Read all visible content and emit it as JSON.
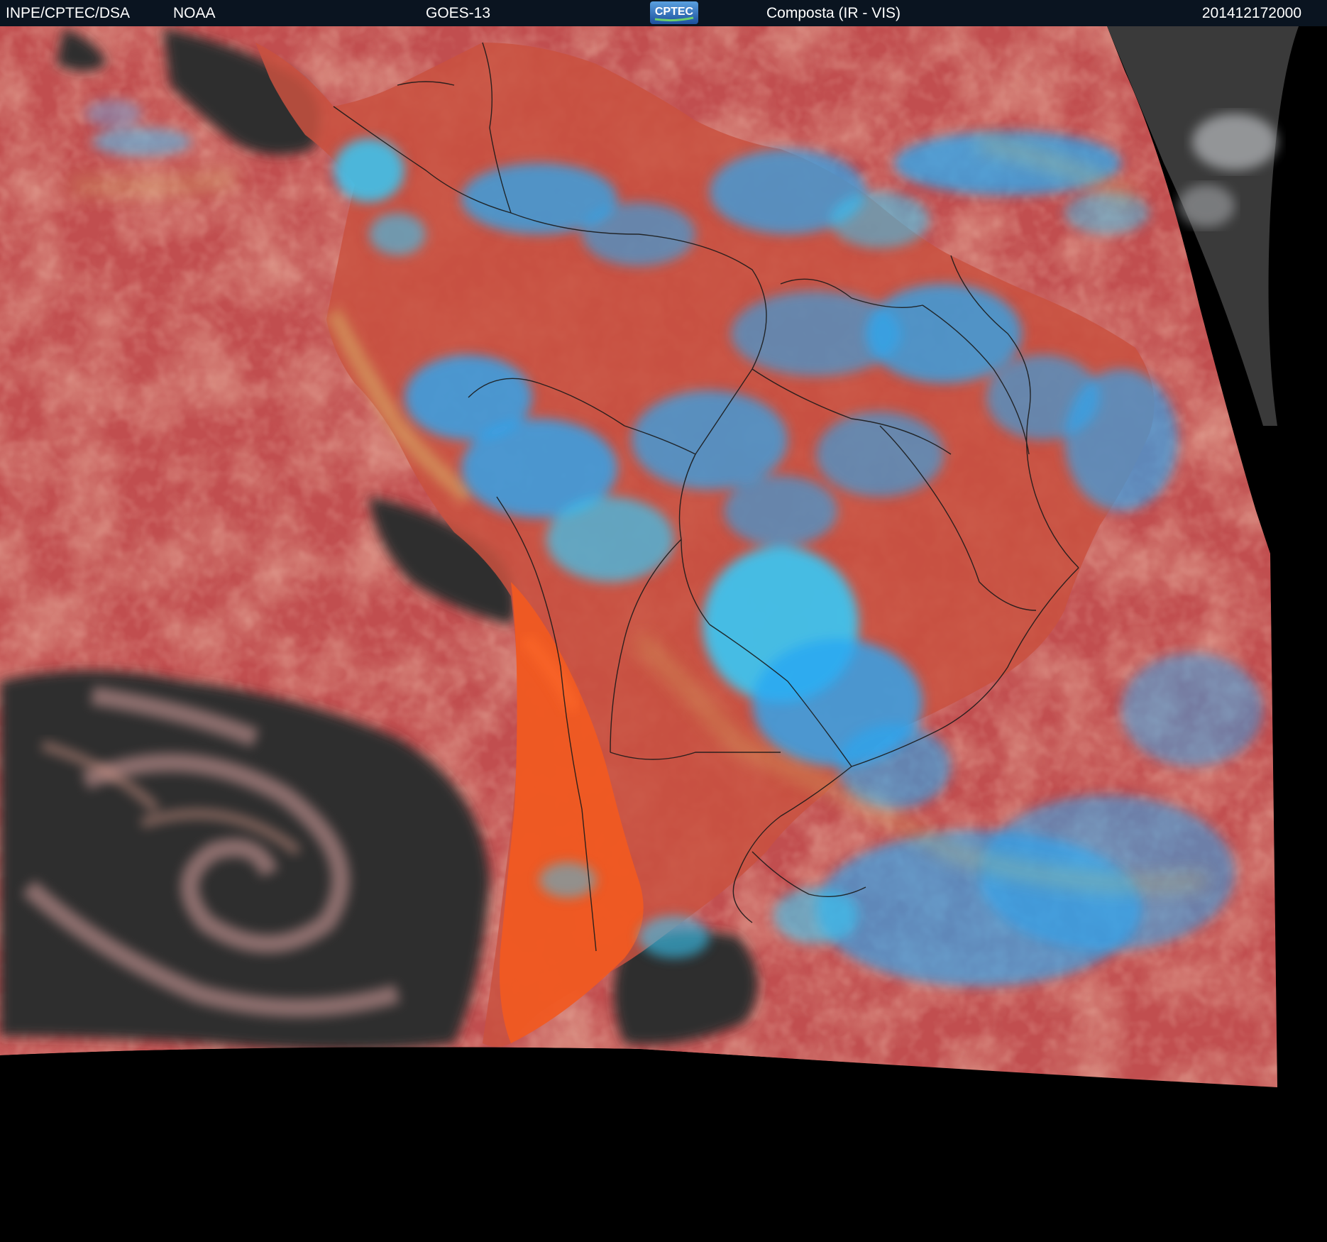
{
  "header": {
    "agency": "INPE/CPTEC/DSA",
    "partner": "NOAA",
    "satellite": "GOES-13",
    "logo_text": "CPTEC",
    "product": "Composta (IR - VIS)",
    "timestamp": "201412172000"
  },
  "colors": {
    "header_bg": "#0a1420",
    "ocean_red": "#c14e4f",
    "land_orange": "#ee5a24",
    "cloud_blue": "#2aa8f2",
    "cloud_cyan": "#36c8f5",
    "clear_dark": "#2f2f2f",
    "border_line": "#1a1a1a",
    "no_data": "#000000"
  }
}
